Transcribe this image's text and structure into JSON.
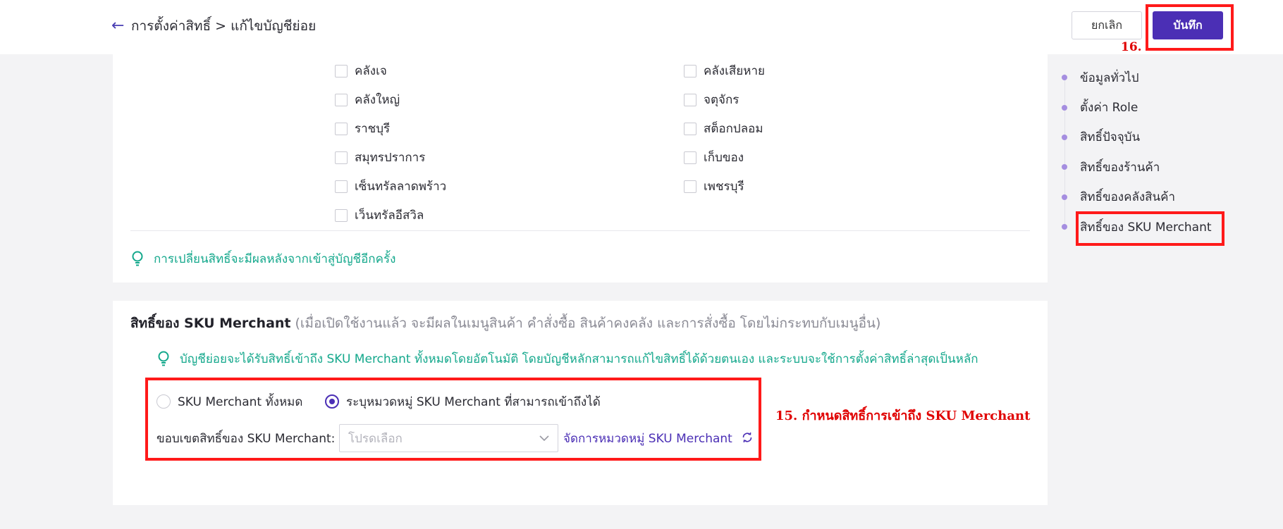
{
  "header": {
    "back_icon": "arrow-left-icon",
    "breadcrumb": "การตั้งค่าสิทธิ์ > แก้ไขบัญชีย่อย",
    "cancel_label": "ยกเลิก",
    "save_label": "บันทึก",
    "accent_color": "#4b2fb5"
  },
  "annotations": {
    "save_step": "16.",
    "sku_step": "15. กำหนดสิทธิ์การเข้าถึง SKU Merchant",
    "highlight_color": "#ff1a1a"
  },
  "warehouses": {
    "left": [
      "คลังเจ",
      "คลังใหญ่",
      "ราชบุรี",
      "สมุทรปราการ",
      "เซ็นทรัลลาดพร้าว",
      "เว็นทรัลอีสวิล"
    ],
    "right": [
      "คลังเสียหาย",
      "จตุจักร",
      "สต็อกปลอม",
      "เก็บของ",
      "เพชรบุรี"
    ]
  },
  "warehouse_tip": {
    "icon": "lightbulb-icon",
    "text": "การเปลี่ยนสิทธิ์จะมีผลหลังจากเข้าสู่บัญชีอีกครั้ง",
    "color": "#14a88c"
  },
  "sku_section": {
    "title": "สิทธิ์ของ SKU Merchant",
    "description": "(เมื่อเปิดใช้งานแล้ว จะมีผลในเมนูสินค้า คำสั่งซื้อ สินค้าคงคลัง และการสั่งซื้อ โดยไม่กระทบกับเมนูอื่น)",
    "tip": "บัญชีย่อยจะได้รับสิทธิ์เข้าถึง SKU Merchant ทั้งหมดโดยอัตโนมัติ โดยบัญชีหลักสามารถแก้ไขสิทธิ์ได้ด้วยตนเอง และระบบจะใช้การตั้งค่าสิทธิ์ล่าสุดเป็นหลัก",
    "radio_all": "SKU Merchant ทั้งหมด",
    "radio_specific": "ระบุหมวดหมู่ SKU Merchant ที่สามารถเข้าถึงได้",
    "selected_radio": "radio_specific",
    "scope_label": "ขอบเขตสิทธิ์ของ SKU Merchant:",
    "select_placeholder": "โปรดเลือก",
    "manage_link": "จัดการหมวดหมู่ SKU Merchant",
    "refresh_icon": "refresh-icon"
  },
  "side_nav": {
    "items": [
      "ข้อมูลทั่วไป",
      "ตั้งค่า Role",
      "สิทธิ์ปัจจุบัน",
      "สิทธิ์ของร้านค้า",
      "สิทธิ์ของคลังสินค้า",
      "สิทธิ์ของ SKU Merchant"
    ]
  }
}
